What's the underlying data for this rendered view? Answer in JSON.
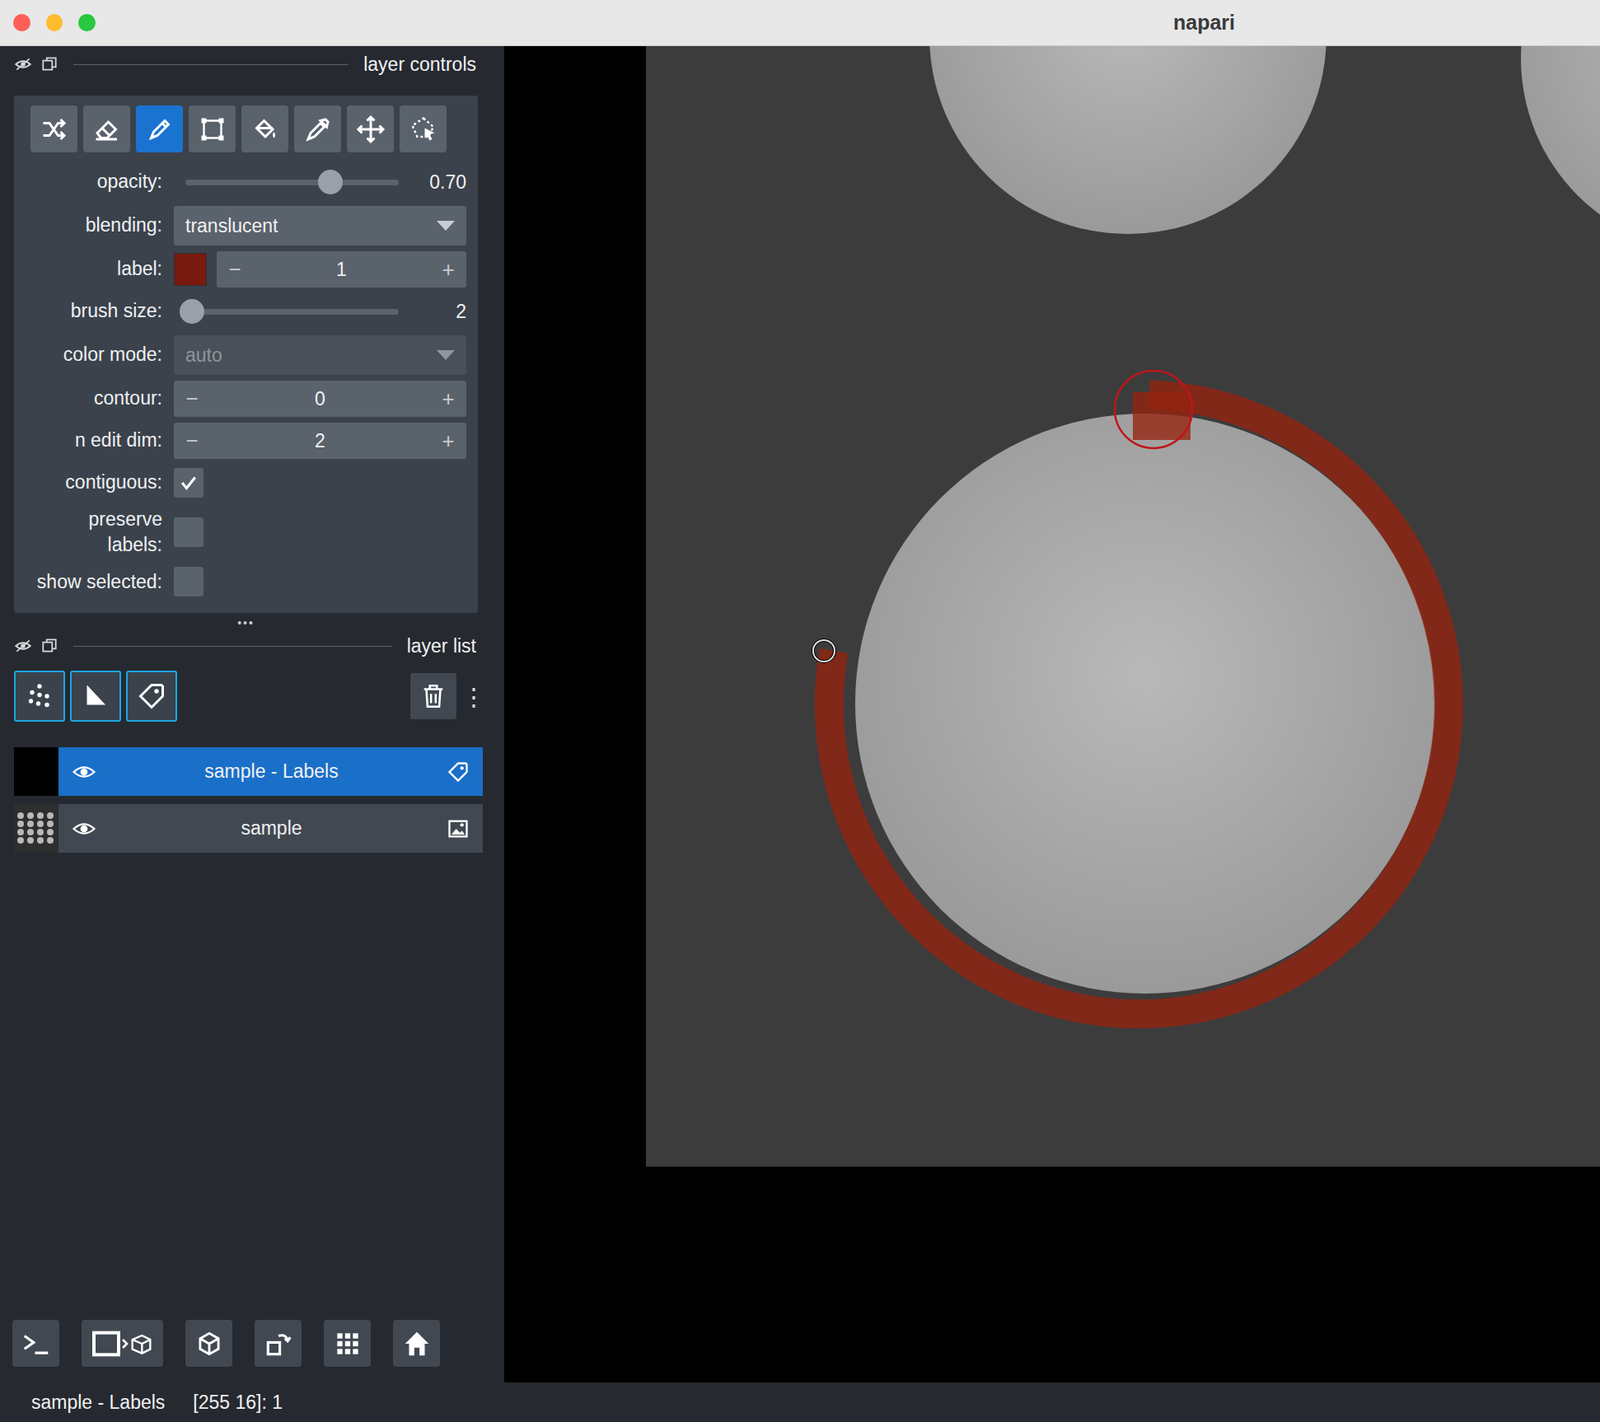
{
  "window": {
    "title": "napari"
  },
  "layer_controls": {
    "title": "layer controls",
    "tools": [
      {
        "selected": false
      },
      {
        "selected": false
      },
      {
        "selected": true
      },
      {
        "selected": false
      },
      {
        "selected": false
      },
      {
        "selected": false
      },
      {
        "selected": false
      },
      {
        "selected": false
      }
    ],
    "rows": [
      {
        "kind": "slider",
        "label": "opacity:",
        "level": 0.68,
        "reading": "0.70"
      },
      {
        "kind": "dropdown",
        "label": "blending:",
        "value": "translucent",
        "disabled": false
      },
      {
        "kind": "color-spin",
        "label": "label:",
        "value": "1",
        "swatch": "#7a1a0e"
      },
      {
        "kind": "slider",
        "label": "brush size:",
        "level": 0.03,
        "reading": "2"
      },
      {
        "kind": "dropdown",
        "label": "color mode:",
        "value": "auto",
        "disabled": true
      },
      {
        "kind": "spin",
        "label": "contour:",
        "value": "0"
      },
      {
        "kind": "spin",
        "label": "n edit dim:",
        "value": "2"
      },
      {
        "kind": "checkbox",
        "label": "contiguous:",
        "checked": true
      },
      {
        "kind": "checkbox",
        "label": "preserve labels:",
        "checked": false
      },
      {
        "kind": "checkbox",
        "label": "show selected:",
        "checked": false
      }
    ],
    "spin_minus": "−",
    "spin_plus": "+"
  },
  "handle": "•••",
  "layer_list": {
    "title": "layer list",
    "menu": "⋮",
    "layers": [
      {
        "name": "sample - Labels",
        "selected": true,
        "kind": "labels"
      },
      {
        "name": "sample",
        "selected": false,
        "kind": "image"
      }
    ]
  },
  "status_bar": {
    "layer": "sample - Labels",
    "position": "[255 16]: 1"
  }
}
